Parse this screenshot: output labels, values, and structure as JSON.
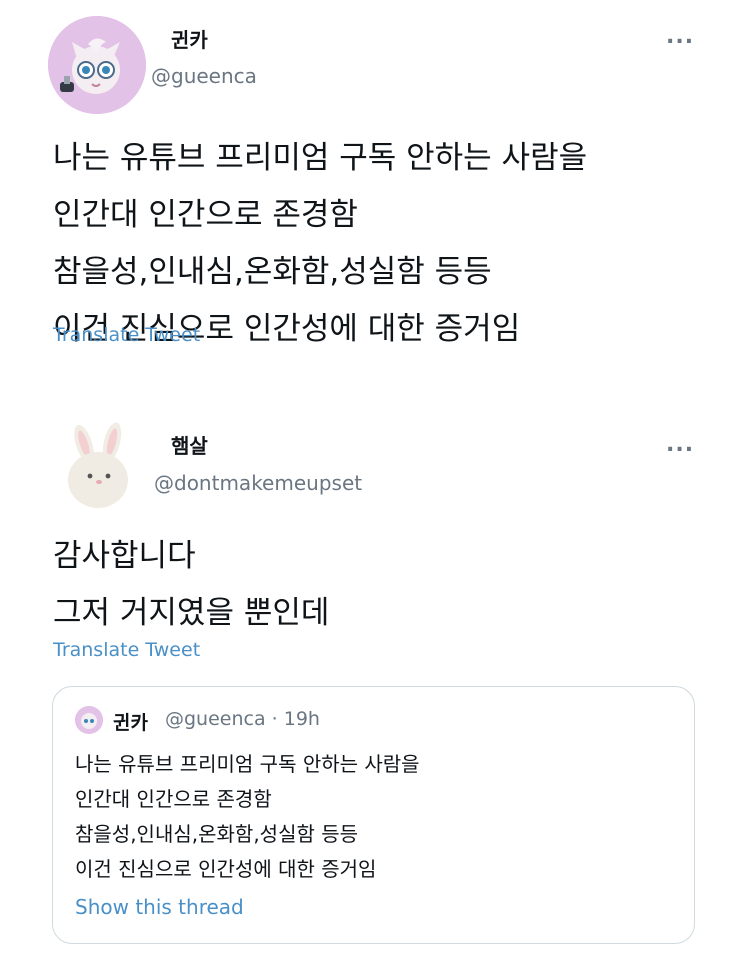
{
  "tweet1": {
    "display_name": "귄카",
    "handle": "@gueenca",
    "more": "...",
    "body_lines": [
      "나는 유튜브 프리미엄 구독 안하는 사람을",
      "인간대 인간으로 존경함",
      "참을성,인내심,온화함,성실함 등등",
      "이건 진심으로 인간성에 대한 증거임"
    ],
    "translate": "Translate Tweet"
  },
  "tweet2": {
    "display_name": "햄살",
    "handle": "@dontmakemeupset",
    "more": "...",
    "body_lines": [
      "감사합니다",
      "그저 거지였을 뿐인데"
    ],
    "translate": "Translate Tweet",
    "quote": {
      "display_name": "귄카",
      "meta": "@gueenca · 19h",
      "body_lines": [
        "나는 유튜브 프리미엄 구독 안하는 사람을",
        "인간대 인간으로 존경함",
        "참을성,인내심,온화함,성실함 등등",
        "이건 진심으로 인간성에 대한 증거임"
      ],
      "show_thread": "Show this thread"
    }
  },
  "colors": {
    "link": "#4a90c8",
    "secondary_text": "#6a7682",
    "border": "#cfd9de"
  }
}
